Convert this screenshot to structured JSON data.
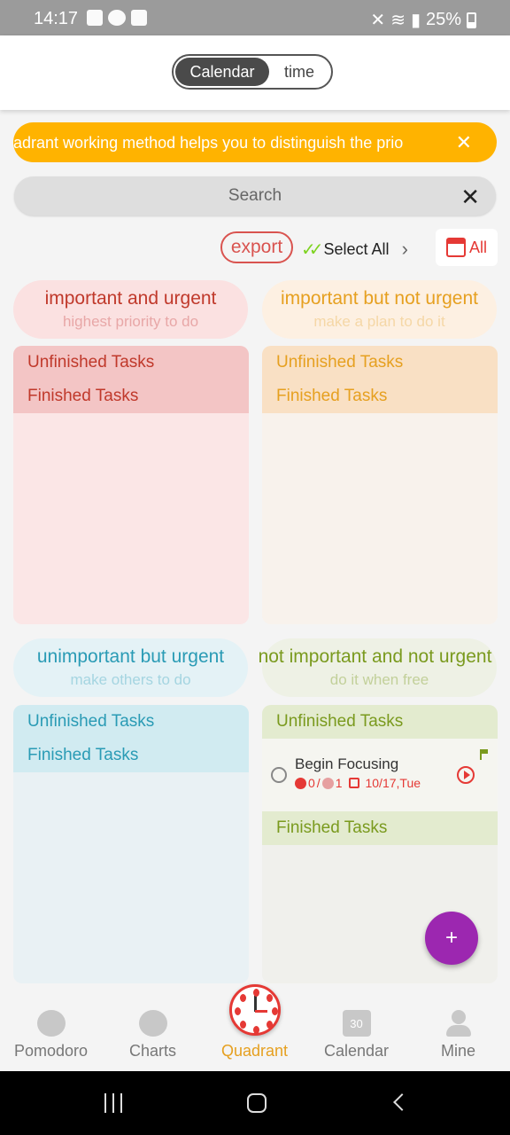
{
  "status_bar": {
    "time": "14:17",
    "battery": "25%"
  },
  "header": {
    "segments": [
      "Calendar",
      "time"
    ],
    "active_segment": "Calendar"
  },
  "banner": {
    "text": "quadrant working method helps you to distinguish the prio",
    "close_icon": "close-icon"
  },
  "search": {
    "placeholder": "Search",
    "value": ""
  },
  "toolbar": {
    "export_label": "export",
    "select_all_label": "Select All",
    "filter_label": "All"
  },
  "quadrants": [
    {
      "title": "important and urgent",
      "subtitle": "highest priority to do",
      "unfinished_label": "Unfinished Tasks",
      "finished_label": "Finished Tasks",
      "color": "#c0392b"
    },
    {
      "title": "important but not urgent",
      "subtitle": "make a plan to do it",
      "unfinished_label": "Unfinished Tasks",
      "finished_label": "Finished Tasks",
      "color": "#e6a020"
    },
    {
      "title": "unimportant but urgent",
      "subtitle": "make others to do",
      "unfinished_label": "Unfinished Tasks",
      "finished_label": "Finished Tasks",
      "color": "#2a9bb5"
    },
    {
      "title": "not important and not urgent",
      "subtitle": "do it when free",
      "unfinished_label": "Unfinished Tasks",
      "finished_label": "Finished Tasks",
      "color": "#7a9a1e",
      "tasks": [
        {
          "name": "Begin Focusing",
          "done_pomodoros": "0",
          "total_pomodoros": "1",
          "date": "10/17,Tue"
        }
      ]
    }
  ],
  "fab": {
    "label": "+"
  },
  "tabs": [
    {
      "label": "Pomodoro",
      "icon": "tomato-icon"
    },
    {
      "label": "Charts",
      "icon": "chart-icon"
    },
    {
      "label": "Quadrant",
      "icon": "clock-icon",
      "active": true
    },
    {
      "label": "Calendar",
      "icon": "calendar-icon",
      "icon_text": "30"
    },
    {
      "label": "Mine",
      "icon": "person-icon"
    }
  ],
  "colors": {
    "accent": "#e6a020",
    "banner": "#ffb300",
    "fab": "#9c27b0",
    "danger": "#e53935"
  }
}
